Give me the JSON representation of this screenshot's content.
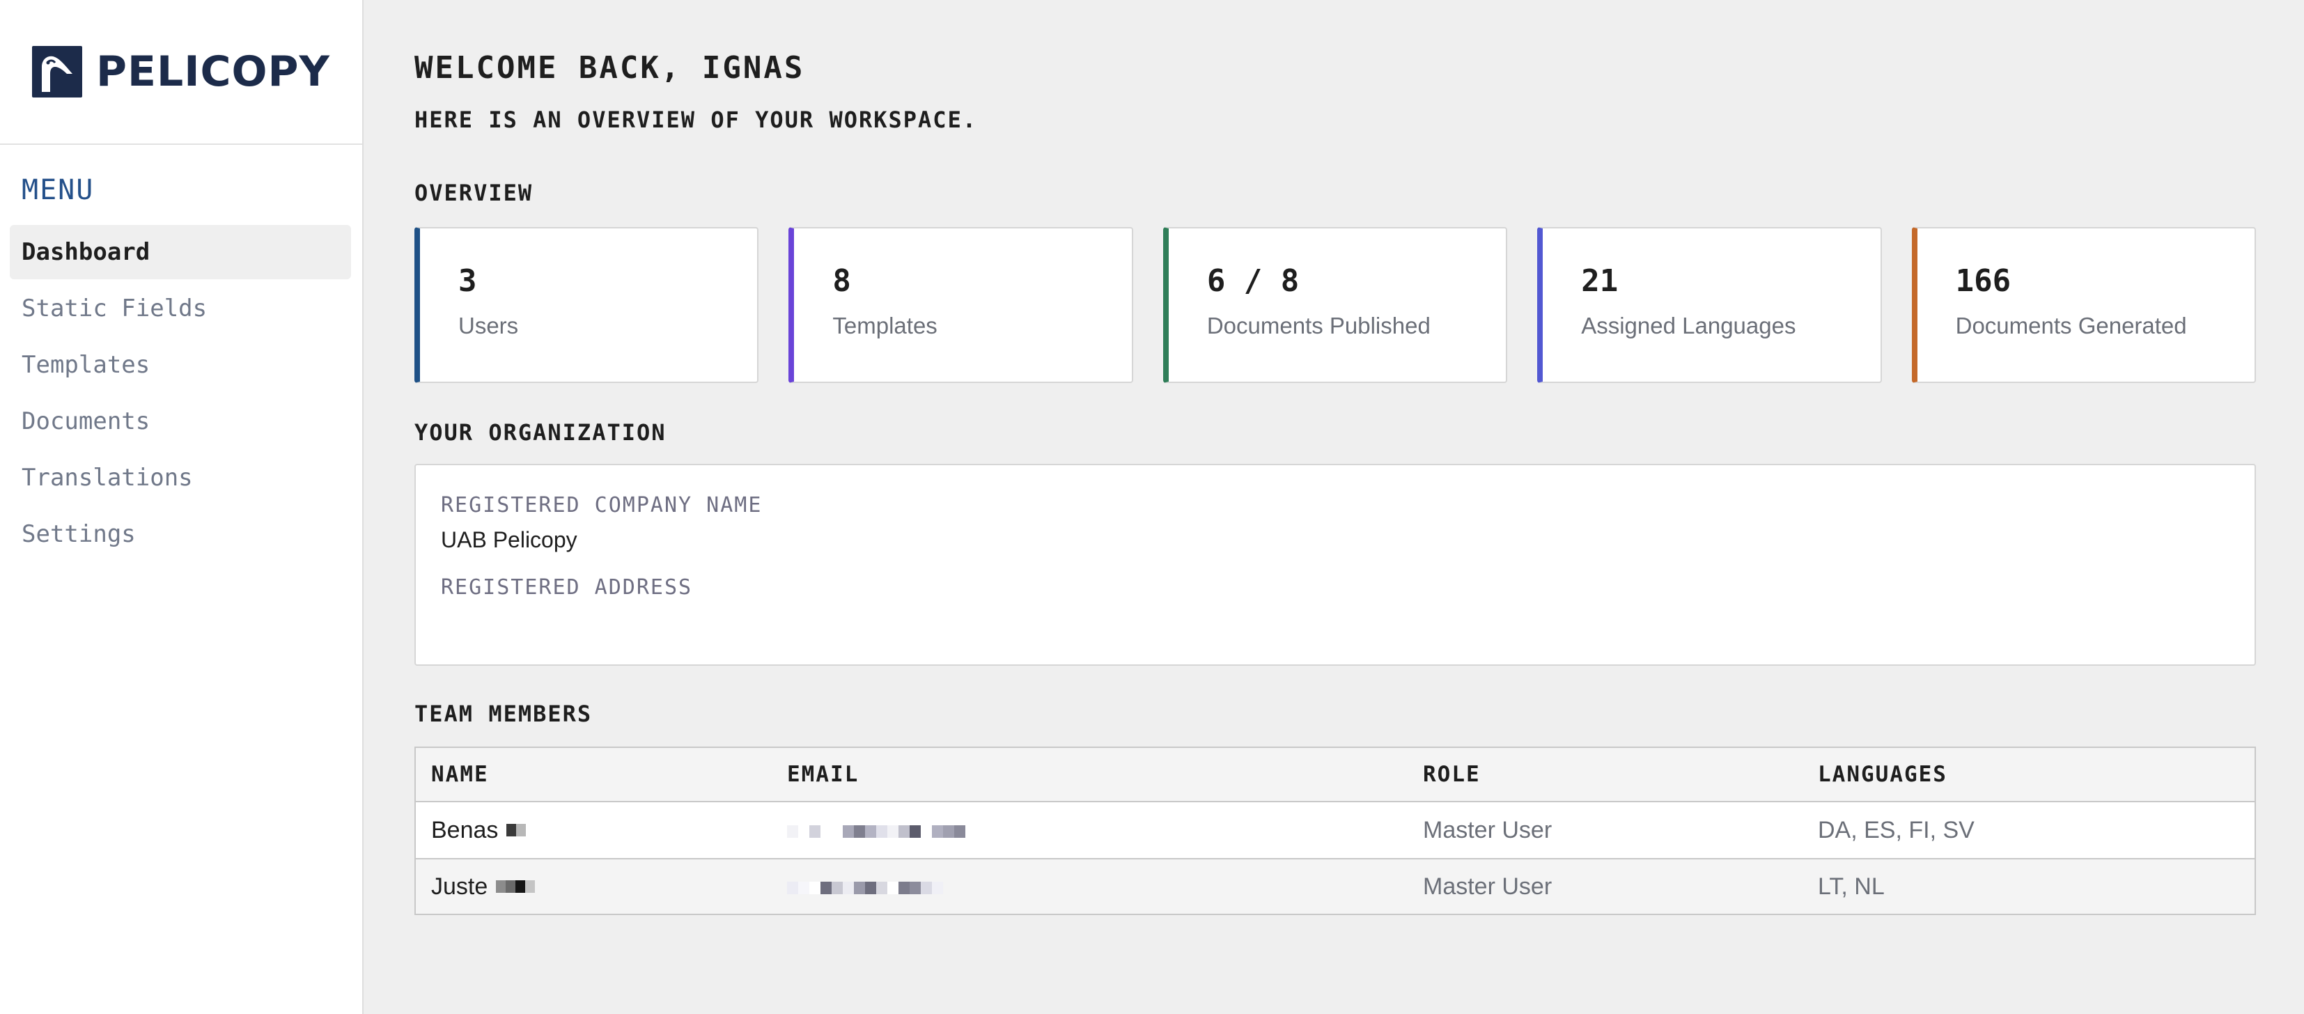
{
  "brand": {
    "name": "PELICOPY",
    "logo": "pelican-logo-icon"
  },
  "sidebar": {
    "menu_heading": "MENU",
    "items": [
      {
        "label": "Dashboard",
        "active": true
      },
      {
        "label": "Static Fields",
        "active": false
      },
      {
        "label": "Templates",
        "active": false
      },
      {
        "label": "Documents",
        "active": false
      },
      {
        "label": "Translations",
        "active": false
      },
      {
        "label": "Settings",
        "active": false
      }
    ]
  },
  "header": {
    "welcome": "WELCOME BACK, IGNAS",
    "subtitle": "HERE IS AN OVERVIEW OF YOUR WORKSPACE."
  },
  "overview": {
    "title": "OVERVIEW",
    "stats": [
      {
        "value": "3",
        "label": "Users",
        "accent": "#1f5186"
      },
      {
        "value": "8",
        "label": "Templates",
        "accent": "#6a44d8"
      },
      {
        "value": "6 / 8",
        "label": "Documents Published",
        "accent": "#2f7e58"
      },
      {
        "value": "21",
        "label": "Assigned Languages",
        "accent": "#5258d2"
      },
      {
        "value": "166",
        "label": "Documents Generated",
        "accent": "#c4692a"
      }
    ]
  },
  "organization": {
    "title": "YOUR ORGANIZATION",
    "company_label": "REGISTERED COMPANY NAME",
    "company_value": "UAB Pelicopy",
    "address_label": "REGISTERED ADDRESS",
    "address_value": ""
  },
  "team": {
    "title": "TEAM MEMBERS",
    "columns": [
      "NAME",
      "EMAIL",
      "ROLE",
      "LANGUAGES"
    ],
    "rows": [
      {
        "name": "Benas",
        "email": "",
        "role": "Master User",
        "languages": "DA, ES, FI, SV"
      },
      {
        "name": "Juste",
        "email": "",
        "role": "Master User",
        "languages": "LT, NL"
      }
    ]
  }
}
